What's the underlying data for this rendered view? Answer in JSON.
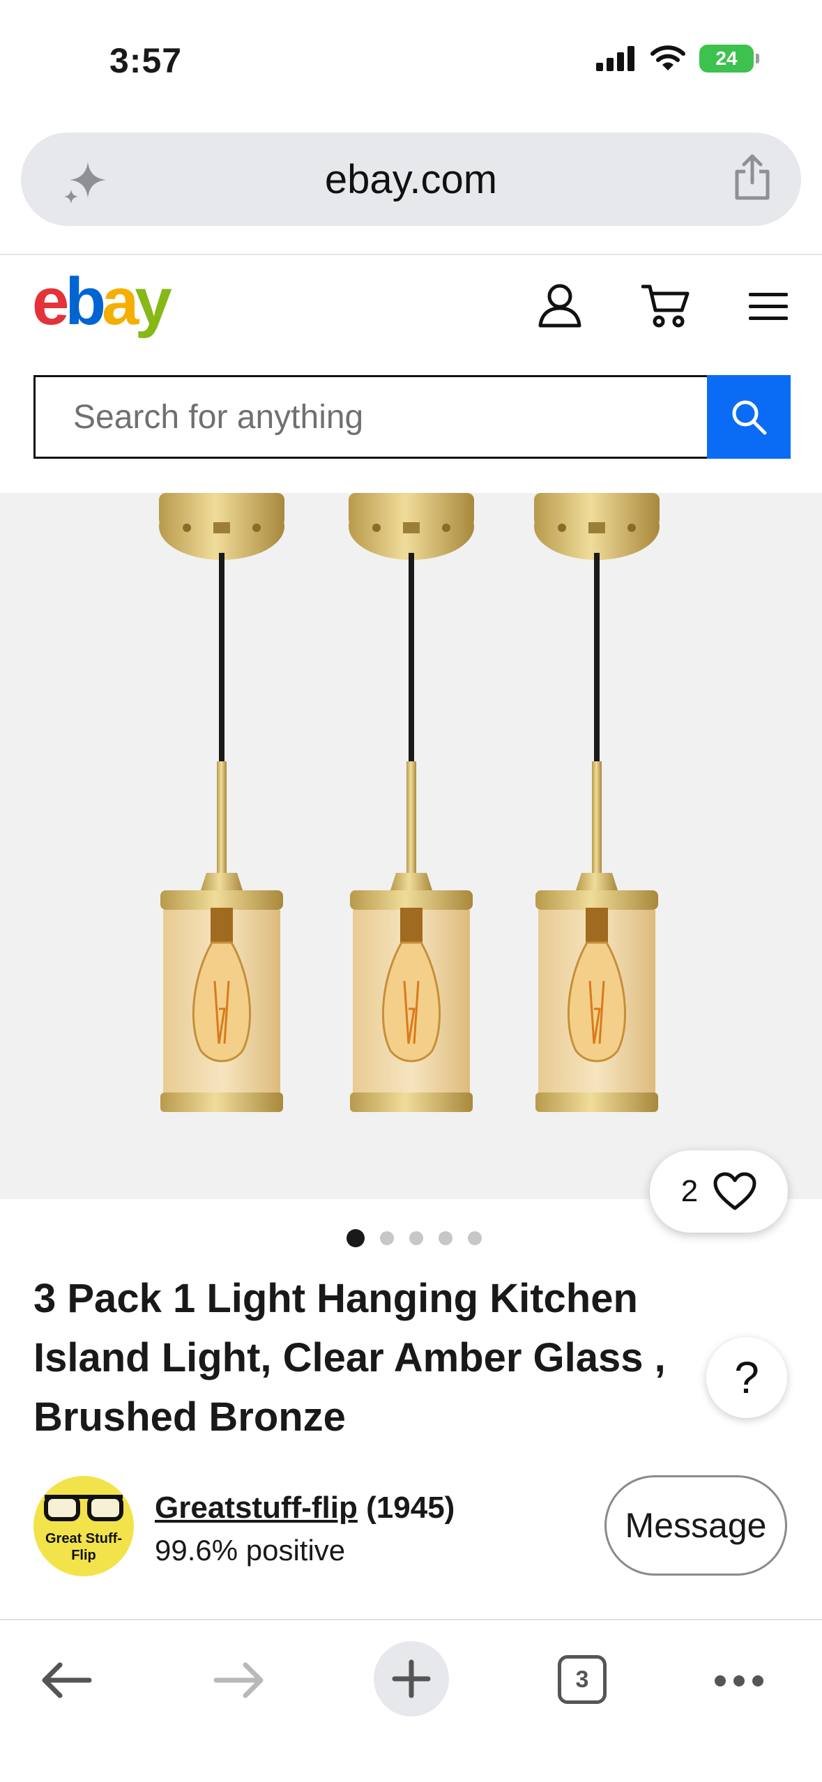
{
  "status_bar": {
    "time": "3:57",
    "battery": "24"
  },
  "browser": {
    "url": "ebay.com"
  },
  "header": {
    "logo": {
      "e": "e",
      "b": "b",
      "a": "a",
      "y": "y"
    },
    "logo_colors": {
      "e": "#e53238",
      "b": "#0064d2",
      "a": "#f5af02",
      "y": "#86b817"
    }
  },
  "search": {
    "placeholder": "Search for anything",
    "button_color": "#0a6cf5"
  },
  "gallery": {
    "image_count": 5,
    "active_index": 0,
    "watch_count": "2"
  },
  "product": {
    "title": "3 Pack 1 Light Hanging Kitchen Island Light, Clear Amber Glass , Brushed Bronze"
  },
  "seller": {
    "name": "Greatstuff-flip",
    "feedback_count": "(1945)",
    "positive": "99.6% positive",
    "avatar_text": "Great Stuff-\nFlip",
    "message_label": "Message"
  },
  "help": {
    "label": "?"
  },
  "toolbar": {
    "tabs_count": "3"
  }
}
